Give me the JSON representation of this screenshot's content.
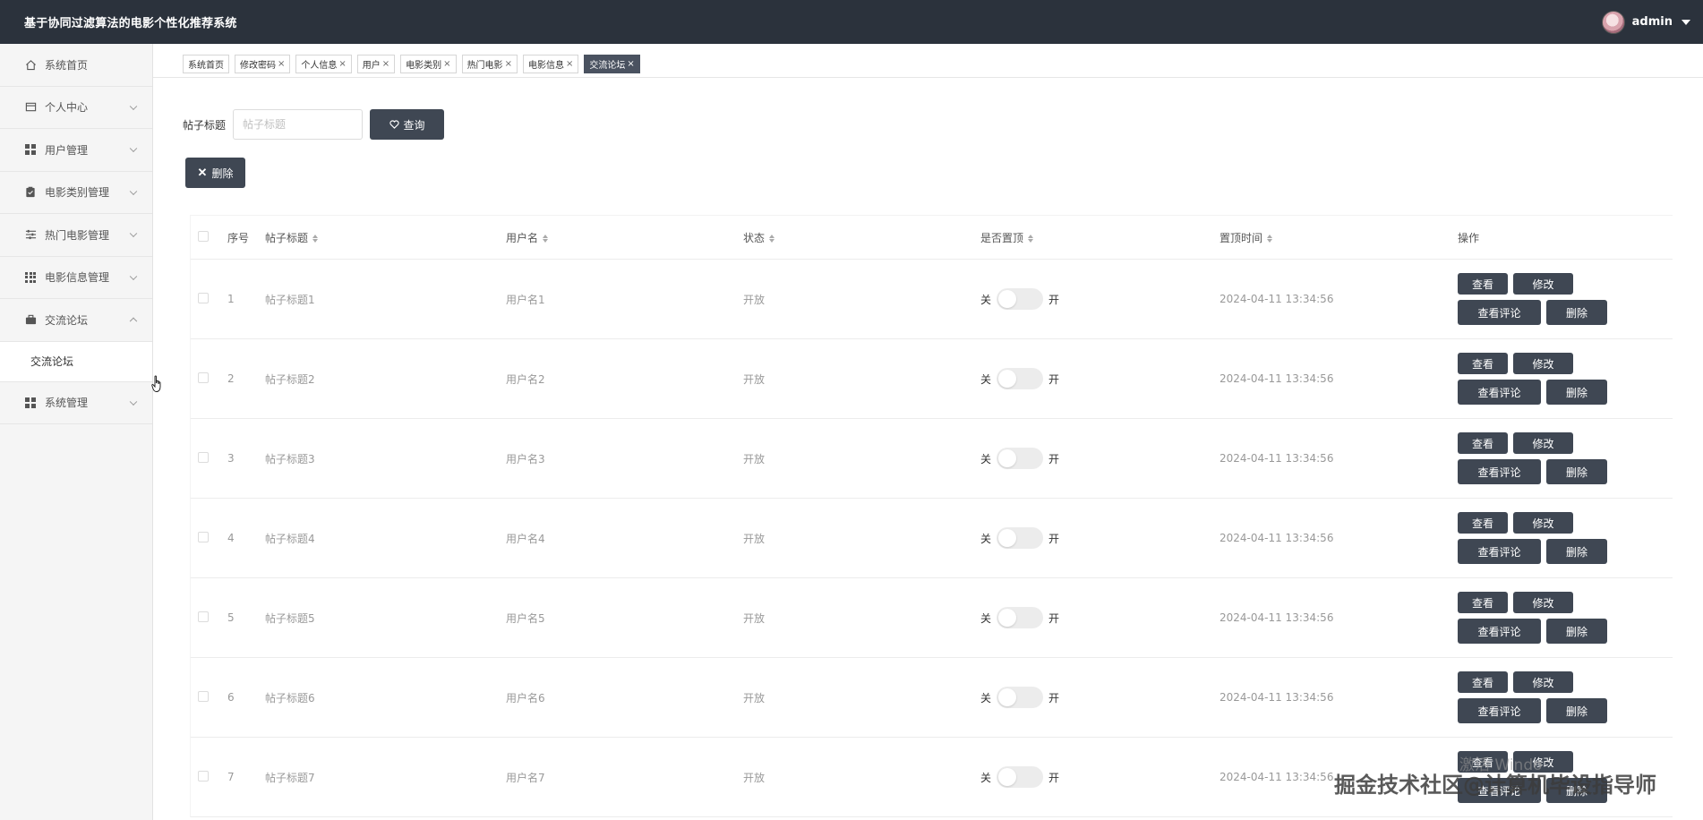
{
  "app": {
    "title": "基于协同过滤算法的电影个性化推荐系统",
    "user": "admin"
  },
  "sidebar": {
    "items": [
      {
        "label": "系统首页",
        "icon": "home-icon"
      },
      {
        "label": "个人中心",
        "icon": "card-icon"
      },
      {
        "label": "用户管理",
        "icon": "grid-icon"
      },
      {
        "label": "电影类别管理",
        "icon": "clipboard-icon"
      },
      {
        "label": "热门电影管理",
        "icon": "sliders-icon"
      },
      {
        "label": "电影信息管理",
        "icon": "grid9-icon"
      },
      {
        "label": "交流论坛",
        "icon": "briefcase-icon"
      },
      {
        "label": "系统管理",
        "icon": "grid-icon"
      }
    ],
    "sub_item": "交流论坛"
  },
  "tabs": [
    {
      "label": "系统首页"
    },
    {
      "label": "修改密码",
      "close": "×"
    },
    {
      "label": "个人信息",
      "close": "×"
    },
    {
      "label": "用户",
      "close": "×"
    },
    {
      "label": "电影类别",
      "close": "×"
    },
    {
      "label": "热门电影",
      "close": "×"
    },
    {
      "label": "电影信息",
      "close": "×"
    },
    {
      "label": "交流论坛",
      "close": "×",
      "active": true
    }
  ],
  "search": {
    "label": "帖子标题",
    "placeholder": "帖子标题",
    "button": "查询"
  },
  "bulk_delete": "删除",
  "table": {
    "headers": {
      "index": "序号",
      "title": "帖子标题",
      "user": "用户名",
      "state": "状态",
      "top": "是否置顶",
      "time": "置顶时间",
      "ops": "操作"
    },
    "switch_off": "关",
    "switch_on": "开",
    "actions": {
      "view": "查看",
      "edit": "修改",
      "comments": "查看评论",
      "delete": "删除"
    },
    "rows": [
      {
        "index": "1",
        "title": "帖子标题1",
        "user": "用户名1",
        "state": "开放",
        "time": "2024-04-11 13:34:56"
      },
      {
        "index": "2",
        "title": "帖子标题2",
        "user": "用户名2",
        "state": "开放",
        "time": "2024-04-11 13:34:56"
      },
      {
        "index": "3",
        "title": "帖子标题3",
        "user": "用户名3",
        "state": "开放",
        "time": "2024-04-11 13:34:56"
      },
      {
        "index": "4",
        "title": "帖子标题4",
        "user": "用户名4",
        "state": "开放",
        "time": "2024-04-11 13:34:56"
      },
      {
        "index": "5",
        "title": "帖子标题5",
        "user": "用户名5",
        "state": "开放",
        "time": "2024-04-11 13:34:56"
      },
      {
        "index": "6",
        "title": "帖子标题6",
        "user": "用户名6",
        "state": "开放",
        "time": "2024-04-11 13:34:56"
      },
      {
        "index": "7",
        "title": "帖子标题7",
        "user": "用户名7",
        "state": "开放",
        "time": "2024-04-11 13:34:56"
      }
    ]
  },
  "watermark": "掘金技术社区@计算机毕设指导师",
  "activate_text": "激活 Windo"
}
